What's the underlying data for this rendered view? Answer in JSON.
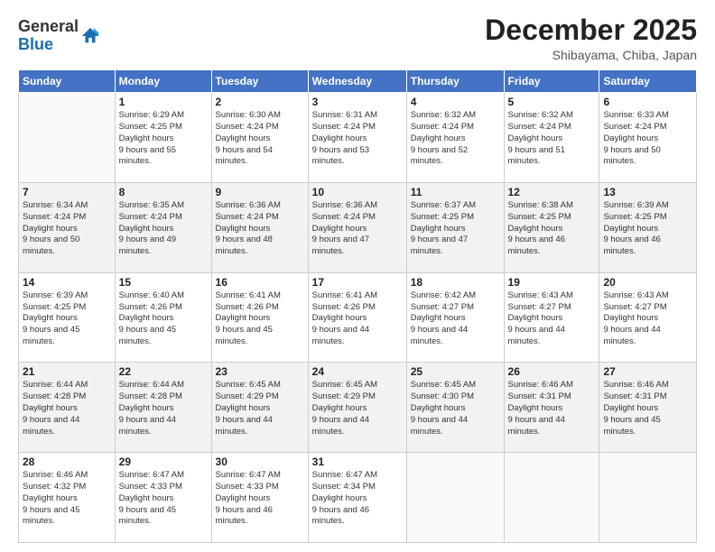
{
  "logo": {
    "general": "General",
    "blue": "Blue"
  },
  "title": "December 2025",
  "location": "Shibayama, Chiba, Japan",
  "weekdays": [
    "Sunday",
    "Monday",
    "Tuesday",
    "Wednesday",
    "Thursday",
    "Friday",
    "Saturday"
  ],
  "weeks": [
    [
      {
        "day": null
      },
      {
        "day": 1,
        "sunrise": "6:29 AM",
        "sunset": "4:25 PM",
        "daylight": "9 hours and 55 minutes."
      },
      {
        "day": 2,
        "sunrise": "6:30 AM",
        "sunset": "4:24 PM",
        "daylight": "9 hours and 54 minutes."
      },
      {
        "day": 3,
        "sunrise": "6:31 AM",
        "sunset": "4:24 PM",
        "daylight": "9 hours and 53 minutes."
      },
      {
        "day": 4,
        "sunrise": "6:32 AM",
        "sunset": "4:24 PM",
        "daylight": "9 hours and 52 minutes."
      },
      {
        "day": 5,
        "sunrise": "6:32 AM",
        "sunset": "4:24 PM",
        "daylight": "9 hours and 51 minutes."
      },
      {
        "day": 6,
        "sunrise": "6:33 AM",
        "sunset": "4:24 PM",
        "daylight": "9 hours and 50 minutes."
      }
    ],
    [
      {
        "day": 7,
        "sunrise": "6:34 AM",
        "sunset": "4:24 PM",
        "daylight": "9 hours and 50 minutes."
      },
      {
        "day": 8,
        "sunrise": "6:35 AM",
        "sunset": "4:24 PM",
        "daylight": "9 hours and 49 minutes."
      },
      {
        "day": 9,
        "sunrise": "6:36 AM",
        "sunset": "4:24 PM",
        "daylight": "9 hours and 48 minutes."
      },
      {
        "day": 10,
        "sunrise": "6:36 AM",
        "sunset": "4:24 PM",
        "daylight": "9 hours and 47 minutes."
      },
      {
        "day": 11,
        "sunrise": "6:37 AM",
        "sunset": "4:25 PM",
        "daylight": "9 hours and 47 minutes."
      },
      {
        "day": 12,
        "sunrise": "6:38 AM",
        "sunset": "4:25 PM",
        "daylight": "9 hours and 46 minutes."
      },
      {
        "day": 13,
        "sunrise": "6:39 AM",
        "sunset": "4:25 PM",
        "daylight": "9 hours and 46 minutes."
      }
    ],
    [
      {
        "day": 14,
        "sunrise": "6:39 AM",
        "sunset": "4:25 PM",
        "daylight": "9 hours and 45 minutes."
      },
      {
        "day": 15,
        "sunrise": "6:40 AM",
        "sunset": "4:26 PM",
        "daylight": "9 hours and 45 minutes."
      },
      {
        "day": 16,
        "sunrise": "6:41 AM",
        "sunset": "4:26 PM",
        "daylight": "9 hours and 45 minutes."
      },
      {
        "day": 17,
        "sunrise": "6:41 AM",
        "sunset": "4:26 PM",
        "daylight": "9 hours and 44 minutes."
      },
      {
        "day": 18,
        "sunrise": "6:42 AM",
        "sunset": "4:27 PM",
        "daylight": "9 hours and 44 minutes."
      },
      {
        "day": 19,
        "sunrise": "6:43 AM",
        "sunset": "4:27 PM",
        "daylight": "9 hours and 44 minutes."
      },
      {
        "day": 20,
        "sunrise": "6:43 AM",
        "sunset": "4:27 PM",
        "daylight": "9 hours and 44 minutes."
      }
    ],
    [
      {
        "day": 21,
        "sunrise": "6:44 AM",
        "sunset": "4:28 PM",
        "daylight": "9 hours and 44 minutes."
      },
      {
        "day": 22,
        "sunrise": "6:44 AM",
        "sunset": "4:28 PM",
        "daylight": "9 hours and 44 minutes."
      },
      {
        "day": 23,
        "sunrise": "6:45 AM",
        "sunset": "4:29 PM",
        "daylight": "9 hours and 44 minutes."
      },
      {
        "day": 24,
        "sunrise": "6:45 AM",
        "sunset": "4:29 PM",
        "daylight": "9 hours and 44 minutes."
      },
      {
        "day": 25,
        "sunrise": "6:45 AM",
        "sunset": "4:30 PM",
        "daylight": "9 hours and 44 minutes."
      },
      {
        "day": 26,
        "sunrise": "6:46 AM",
        "sunset": "4:31 PM",
        "daylight": "9 hours and 44 minutes."
      },
      {
        "day": 27,
        "sunrise": "6:46 AM",
        "sunset": "4:31 PM",
        "daylight": "9 hours and 45 minutes."
      }
    ],
    [
      {
        "day": 28,
        "sunrise": "6:46 AM",
        "sunset": "4:32 PM",
        "daylight": "9 hours and 45 minutes."
      },
      {
        "day": 29,
        "sunrise": "6:47 AM",
        "sunset": "4:33 PM",
        "daylight": "9 hours and 45 minutes."
      },
      {
        "day": 30,
        "sunrise": "6:47 AM",
        "sunset": "4:33 PM",
        "daylight": "9 hours and 46 minutes."
      },
      {
        "day": 31,
        "sunrise": "6:47 AM",
        "sunset": "4:34 PM",
        "daylight": "9 hours and 46 minutes."
      },
      {
        "day": null
      },
      {
        "day": null
      },
      {
        "day": null
      }
    ]
  ],
  "labels": {
    "sunrise": "Sunrise:",
    "sunset": "Sunset:",
    "daylight": "Daylight hours"
  }
}
